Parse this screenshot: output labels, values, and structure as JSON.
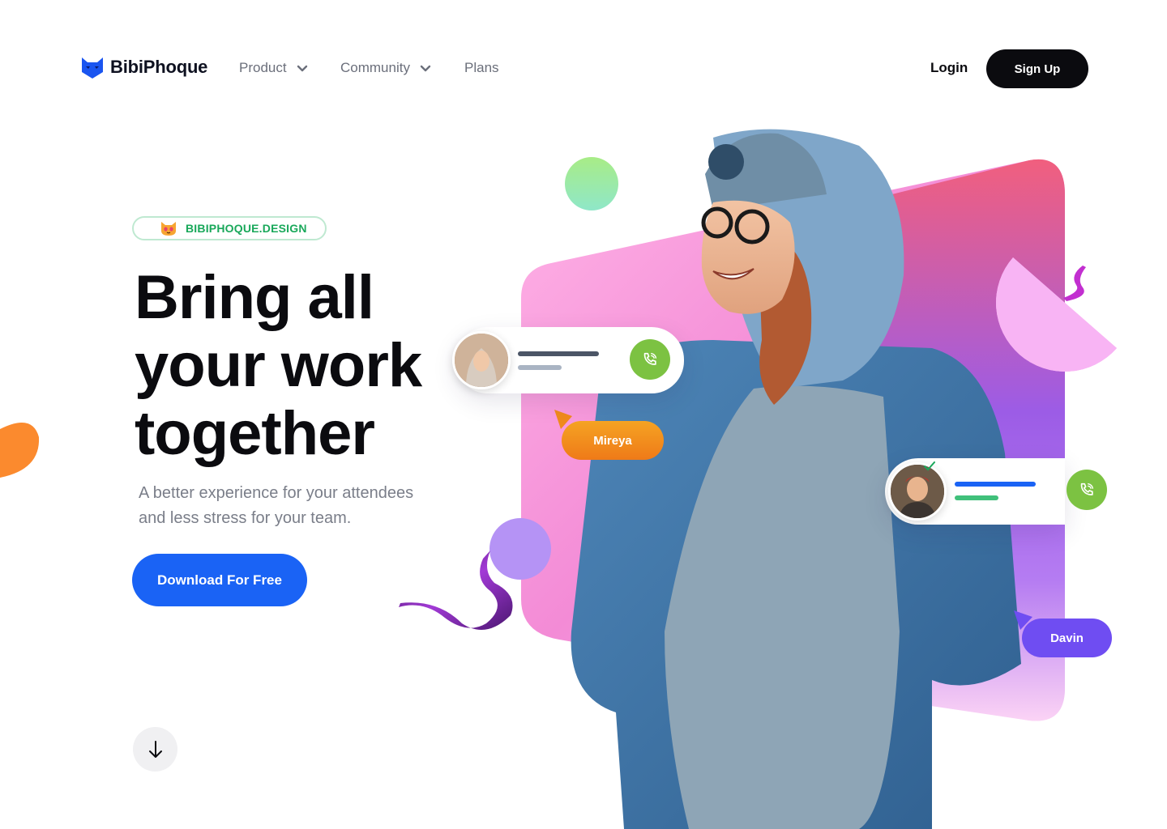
{
  "brand": {
    "name": "BibiPhoque",
    "logo_icon": "cat-logo-icon",
    "color": "#1a55f0"
  },
  "nav": {
    "items": [
      {
        "label": "Product",
        "has_dropdown": true
      },
      {
        "label": "Community",
        "has_dropdown": true
      },
      {
        "label": "Plans",
        "has_dropdown": false
      }
    ],
    "login_label": "Login",
    "signup_label": "Sign Up"
  },
  "hero": {
    "badge": {
      "icon": "cat-emoji-icon",
      "text": "BIBIPHOQUE.DESIGN"
    },
    "headline_lines": [
      "Bring all",
      "your work",
      "together"
    ],
    "subtitle_lines": [
      "A better experience for your attendees",
      "and less stress for your team."
    ],
    "cta_label": "Download For Free",
    "scroll_icon": "arrow-down-icon"
  },
  "call_cards": [
    {
      "caller_tag": "Mireya",
      "tag_color": "#f08a1d",
      "call_icon": "phone-icon",
      "call_color": "#7cc242"
    },
    {
      "caller_tag": "Davin",
      "tag_color": "#6f4df2",
      "call_icon": "phone-icon",
      "call_color": "#7cc242",
      "verified": true
    }
  ],
  "colors": {
    "primary": "#1a63f5",
    "dark": "#0b0b0f",
    "muted_text": "#7a7e89",
    "badge_green": "#19a85a"
  }
}
